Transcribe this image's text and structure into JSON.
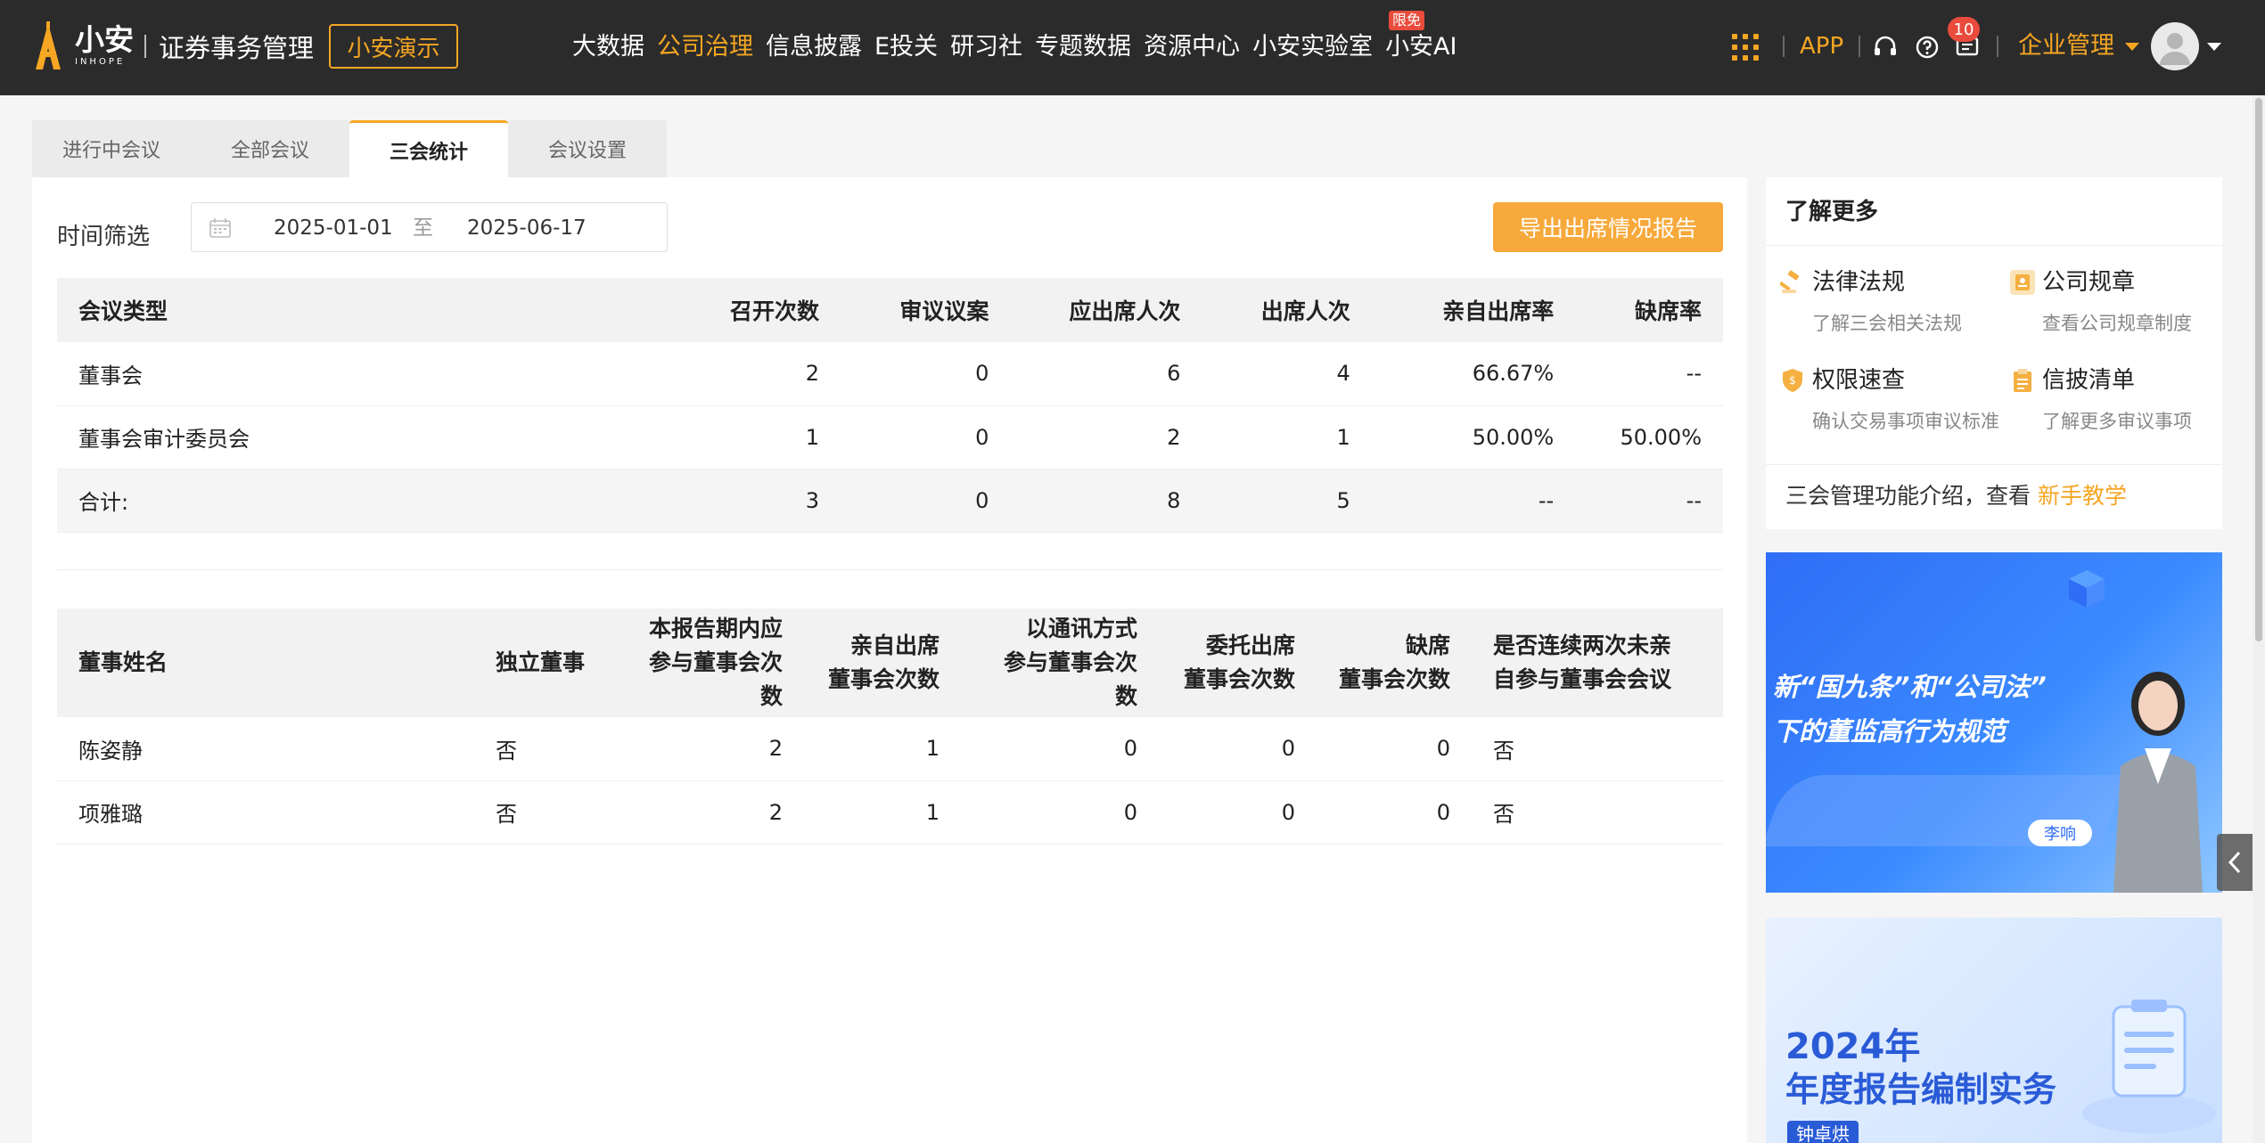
{
  "header": {
    "logo_main": "小安",
    "logo_sub": "INHOPE",
    "product": "证券事务管理",
    "demo_label": "小安演示",
    "nav": [
      "大数据",
      "公司治理",
      "信息披露",
      "E投关",
      "研习社",
      "专题数据",
      "资源中心",
      "小安实验室",
      "小安AI"
    ],
    "nav_active": "公司治理",
    "free_badge": "限免",
    "app_label": "APP",
    "notification_count": "10",
    "enterprise_label": "企业管理",
    "accent_color": "#f5a623"
  },
  "tabs": [
    "进行中会议",
    "全部会议",
    "三会统计",
    "会议设置"
  ],
  "filter": {
    "label": "时间筛选",
    "start": "2025-01-01",
    "separator": "至",
    "end": "2025-06-17",
    "export_label": "导出出席情况报告"
  },
  "meeting_table": {
    "headers": [
      "会议类型",
      "召开次数",
      "审议议案",
      "应出席人次",
      "出席人次",
      "亲自出席率",
      "缺席率"
    ],
    "rows": [
      [
        "董事会",
        "2",
        "0",
        "6",
        "4",
        "66.67%",
        "--"
      ],
      [
        "董事会审计委员会",
        "1",
        "0",
        "2",
        "1",
        "50.00%",
        "50.00%"
      ]
    ],
    "total": [
      "合计:",
      "3",
      "0",
      "8",
      "5",
      "--",
      "--"
    ]
  },
  "director_table": {
    "headers": [
      [
        "董事姓名"
      ],
      [
        "独立董事"
      ],
      [
        "本报告期内应",
        "参与董事会次数"
      ],
      [
        "亲自出席",
        "董事会次数"
      ],
      [
        "以通讯方式",
        "参与董事会次数"
      ],
      [
        "委托出席",
        "董事会次数"
      ],
      [
        "缺席",
        "董事会次数"
      ],
      [
        "是否连续两次未亲",
        "自参与董事会会议"
      ]
    ],
    "rows": [
      [
        "陈姿静",
        "否",
        "2",
        "1",
        "0",
        "0",
        "0",
        "否"
      ],
      [
        "项雅璐",
        "否",
        "2",
        "1",
        "0",
        "0",
        "0",
        "否"
      ]
    ]
  },
  "learn_more": {
    "title": "了解更多",
    "items": [
      {
        "title": "法律法规",
        "sub": "了解三会相关法规",
        "icon": "gavel-icon"
      },
      {
        "title": "公司规章",
        "sub": "查看公司规章制度",
        "icon": "document-icon"
      },
      {
        "title": "权限速查",
        "sub": "确认交易事项审议标准",
        "icon": "shield-icon"
      },
      {
        "title": "信披清单",
        "sub": "了解更多审议事项",
        "icon": "clipboard-icon"
      }
    ],
    "footer_text": "三会管理功能介绍，查看 ",
    "footer_link": "新手教学"
  },
  "banners": {
    "b1_line1": "新“国九条”和“公司法”",
    "b1_line2": "下的董监高行为规范",
    "b1_name": "李响",
    "b2_line1": "2024年",
    "b2_line2": "年度报告编制实务",
    "b2_name": "钟卓烘"
  }
}
